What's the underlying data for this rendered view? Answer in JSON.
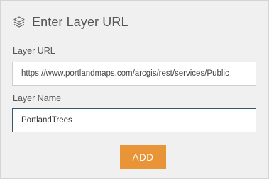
{
  "dialog": {
    "title": "Enter Layer URL",
    "title_icon": "layers-icon"
  },
  "form": {
    "layer_url": {
      "label": "Layer URL",
      "value": "https://www.portlandmaps.com/arcgis/rest/services/Public"
    },
    "layer_name": {
      "label": "Layer Name",
      "value": "PortlandTrees"
    }
  },
  "actions": {
    "add_label": "ADD",
    "add_color": "#e99437"
  },
  "colors": {
    "panel_bg": "#f0f0f0",
    "focus_border": "#37586f"
  }
}
